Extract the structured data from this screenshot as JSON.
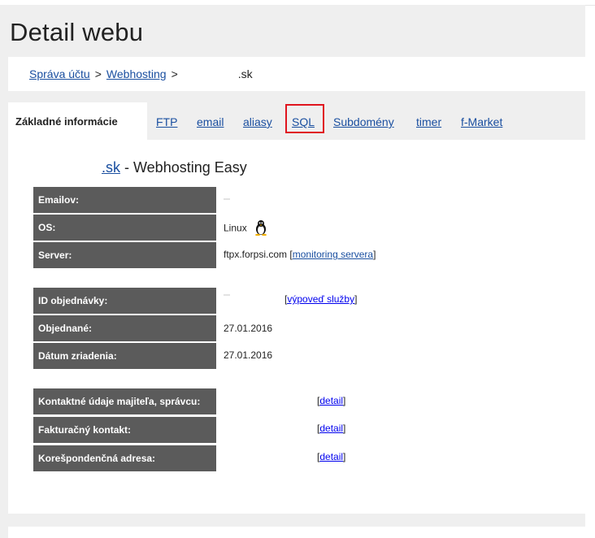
{
  "page": {
    "title": "Detail webu"
  },
  "breadcrumb": {
    "items": [
      "Správa účtu",
      "Webhosting"
    ],
    "separator": ">",
    "current": ".sk"
  },
  "tabs": {
    "active": "Základné informácie",
    "links": [
      "FTP",
      "email",
      "aliasy",
      "SQL",
      "Subdomény",
      "timer",
      "f-Market"
    ],
    "highlighted": "SQL"
  },
  "heading": {
    "link_text": ".sk",
    "suffix": " - Webhosting Easy"
  },
  "info_rows": [
    {
      "label": "Emailov:",
      "value": ""
    },
    {
      "label": "OS:",
      "value": "Linux",
      "icon": "tux-penguin-icon"
    },
    {
      "label": "Server:",
      "value": "ftpx.forpsi.com",
      "link": "monitoring servera"
    }
  ],
  "order_rows": [
    {
      "label": "ID objednávky:",
      "value": "",
      "link": "výpoveď služby"
    },
    {
      "label": "Objednané:",
      "value": "27.01.2016"
    },
    {
      "label": "Dátum zriadenia:",
      "value": "27.01.2016"
    }
  ],
  "contact_rows": [
    {
      "label": "Kontaktné údaje majiteľa, správcu:",
      "link": "detail"
    },
    {
      "label": "Fakturačný kontakt:",
      "link": "detail"
    },
    {
      "label": "Korešpondenčná adresa:",
      "link": "detail"
    }
  ],
  "colors": {
    "link": "#1a4fa0",
    "label_bg": "#5b5b5b",
    "highlight": "#e0141e",
    "page_bg": "#efefef"
  }
}
